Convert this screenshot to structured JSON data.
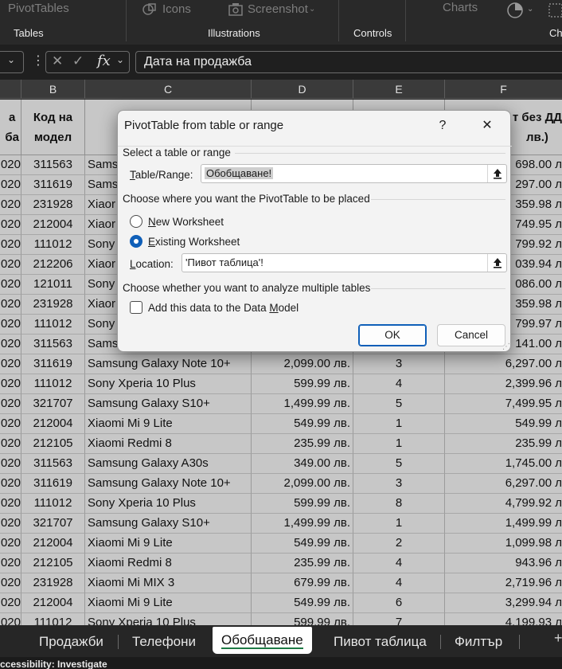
{
  "ribbon": {
    "pivot_tables": "PivotTables",
    "icons": "Icons",
    "screenshot": "Screenshot",
    "charts": "Charts",
    "groups": {
      "tables": "Tables",
      "illustrations": "Illustrations",
      "controls": "Controls",
      "charts_cut": "Ch"
    }
  },
  "formula_bar": {
    "fx": "fx",
    "content": "Дата на продажба"
  },
  "columns": [
    "B",
    "C",
    "D",
    "E",
    "F"
  ],
  "headers": {
    "a": "а\nба",
    "b": "Код на\nмодел",
    "f": "т без ДД\nлв.)"
  },
  "rows": [
    {
      "a": "020",
      "b": "311563",
      "c": "Sams",
      "d": "",
      "e": "",
      "f": "698.00 л"
    },
    {
      "a": "020",
      "b": "311619",
      "c": "Sams",
      "d": "",
      "e": "",
      "f": "297.00 л"
    },
    {
      "a": "020",
      "b": "231928",
      "c": "Xiaor",
      "d": "",
      "e": "",
      "f": "359.98 л"
    },
    {
      "a": "020",
      "b": "212004",
      "c": "Xiaor",
      "d": "",
      "e": "",
      "f": "749.95 л"
    },
    {
      "a": "020",
      "b": "111012",
      "c": "Sony",
      "d": "",
      "e": "",
      "f": "799.92 л"
    },
    {
      "a": "020",
      "b": "212206",
      "c": "Xiaor",
      "d": "",
      "e": "",
      "f": "039.94 л"
    },
    {
      "a": "020",
      "b": "121011",
      "c": "Sony",
      "d": "",
      "e": "",
      "f": "086.00 л"
    },
    {
      "a": "020",
      "b": "231928",
      "c": "Xiaor",
      "d": "",
      "e": "",
      "f": "359.98 л"
    },
    {
      "a": "020",
      "b": "111012",
      "c": "Sony",
      "d": "",
      "e": "",
      "f": "799.97 л"
    },
    {
      "a": "020",
      "b": "311563",
      "c": "Sams",
      "d": "",
      "e": "",
      "f": "141.00 л"
    },
    {
      "a": "020",
      "b": "311619",
      "c": "Samsung Galaxy Note 10+",
      "d": "2,099.00 лв.",
      "e": "3",
      "f": "6,297.00 л"
    },
    {
      "a": "020",
      "b": "111012",
      "c": "Sony Xperia 10 Plus",
      "d": "599.99 лв.",
      "e": "4",
      "f": "2,399.96 л"
    },
    {
      "a": "020",
      "b": "321707",
      "c": "Samsung Galaxy S10+",
      "d": "1,499.99 лв.",
      "e": "5",
      "f": "7,499.95 л"
    },
    {
      "a": "020",
      "b": "212004",
      "c": "Xiaomi Mi 9 Lite",
      "d": "549.99 лв.",
      "e": "1",
      "f": "549.99 л"
    },
    {
      "a": "020",
      "b": "212105",
      "c": "Xiaomi Redmi 8",
      "d": "235.99 лв.",
      "e": "1",
      "f": "235.99 л"
    },
    {
      "a": "020",
      "b": "311563",
      "c": "Samsung Galaxy A30s",
      "d": "349.00 лв.",
      "e": "5",
      "f": "1,745.00 л"
    },
    {
      "a": "020",
      "b": "311619",
      "c": "Samsung Galaxy Note 10+",
      "d": "2,099.00 лв.",
      "e": "3",
      "f": "6,297.00 л"
    },
    {
      "a": "020",
      "b": "111012",
      "c": "Sony Xperia 10 Plus",
      "d": "599.99 лв.",
      "e": "8",
      "f": "4,799.92 л"
    },
    {
      "a": "020",
      "b": "321707",
      "c": "Samsung Galaxy S10+",
      "d": "1,499.99 лв.",
      "e": "1",
      "f": "1,499.99 л"
    },
    {
      "a": "020",
      "b": "212004",
      "c": "Xiaomi Mi 9 Lite",
      "d": "549.99 лв.",
      "e": "2",
      "f": "1,099.98 л"
    },
    {
      "a": "020",
      "b": "212105",
      "c": "Xiaomi Redmi 8",
      "d": "235.99 лв.",
      "e": "4",
      "f": "943.96 л"
    },
    {
      "a": "020",
      "b": "231928",
      "c": "Xiaomi Mi MIX 3",
      "d": "679.99 лв.",
      "e": "4",
      "f": "2,719.96 л"
    },
    {
      "a": "020",
      "b": "212004",
      "c": "Xiaomi Mi 9 Lite",
      "d": "549.99 лв.",
      "e": "6",
      "f": "3,299.94 л"
    },
    {
      "a": "020",
      "b": "111012",
      "c": "Sony Xperia 10 Plus",
      "d": "599.99 лв.",
      "e": "7",
      "f": "4,199.93 л"
    }
  ],
  "dialog": {
    "title": "PivotTable from table or range",
    "help": "?",
    "close": "✕",
    "section_select": "Select a table or range",
    "table_range_label_pre": "",
    "table_range_label_u": "T",
    "table_range_label_post": "able/Range:",
    "table_range_value": "Обобщаване!",
    "section_place": "Choose where you want the PivotTable to be placed",
    "new_ws_u": "N",
    "new_ws_post": "ew Worksheet",
    "existing_ws_u": "E",
    "existing_ws_post": "xisting Worksheet",
    "location_label_u": "L",
    "location_label_post": "ocation:",
    "location_value": "'Пивот таблица'!",
    "section_multi": "Choose whether you want to analyze multiple tables",
    "data_model_pre": "Add this data to the Data ",
    "data_model_u": "M",
    "data_model_post": "odel",
    "ok": "OK",
    "cancel": "Cancel"
  },
  "tabs": [
    "Продажби",
    "Телефони",
    "Обобщаване",
    "Пивот таблица",
    "Филтър"
  ],
  "active_tab": "Обобщаване",
  "status": "ccessibility: Investigate"
}
